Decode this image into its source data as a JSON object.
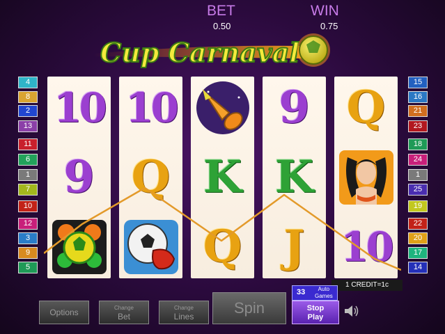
{
  "hud": {
    "bet_label": "BET",
    "bet_value": "0.50",
    "win_label": "WIN",
    "win_value": "0.75"
  },
  "title": "Cup Carnaval",
  "reels": [
    [
      {
        "type": "ten",
        "label": "10",
        "color": "purple"
      },
      {
        "type": "nine",
        "label": "9",
        "color": "purple"
      },
      {
        "type": "icon",
        "icon": "turtle-ball-icon"
      }
    ],
    [
      {
        "type": "ten",
        "label": "10",
        "color": "purple"
      },
      {
        "type": "queen",
        "label": "Q",
        "color": "orange"
      },
      {
        "type": "icon",
        "icon": "ball-glove-icon"
      }
    ],
    [
      {
        "type": "icon",
        "icon": "horn-icon"
      },
      {
        "type": "king",
        "label": "K",
        "color": "green"
      },
      {
        "type": "queen",
        "label": "Q",
        "color": "orange"
      }
    ],
    [
      {
        "type": "nine",
        "label": "9",
        "color": "purple"
      },
      {
        "type": "king",
        "label": "K",
        "color": "green"
      },
      {
        "type": "jack",
        "label": "J",
        "color": "orange"
      }
    ],
    [
      {
        "type": "queen",
        "label": "Q",
        "color": "orange"
      },
      {
        "type": "icon",
        "icon": "carnival-dancer-icon"
      },
      {
        "type": "ten",
        "label": "10",
        "color": "purple"
      }
    ]
  ],
  "paylines_left": [
    {
      "n": "4",
      "color": "#2fb4c8"
    },
    {
      "n": "8",
      "color": "#d9a431"
    },
    {
      "n": "2",
      "color": "#2146d0"
    },
    {
      "n": "13",
      "color": "#8b3fa8"
    },
    {
      "n": "11",
      "color": "#c8202c"
    },
    {
      "n": "6",
      "color": "#22a25b"
    },
    {
      "n": "1",
      "color": "#7a7a7a"
    },
    {
      "n": "7",
      "color": "#a3b81d"
    },
    {
      "n": "10",
      "color": "#c22218"
    },
    {
      "n": "12",
      "color": "#c81f7a"
    },
    {
      "n": "3",
      "color": "#2a7cc8"
    },
    {
      "n": "9",
      "color": "#d88a1f"
    },
    {
      "n": "5",
      "color": "#1f9a57"
    }
  ],
  "paylines_right": [
    {
      "n": "15",
      "color": "#2260c0"
    },
    {
      "n": "16",
      "color": "#2b78c4"
    },
    {
      "n": "21",
      "color": "#d06e1f"
    },
    {
      "n": "23",
      "color": "#b2181f"
    },
    {
      "n": "18",
      "color": "#1f9a57"
    },
    {
      "n": "24",
      "color": "#c81f7a"
    },
    {
      "n": "1",
      "color": "#7a7a7a"
    },
    {
      "n": "25",
      "color": "#4a2db0"
    },
    {
      "n": "19",
      "color": "#c2c81f"
    },
    {
      "n": "22",
      "color": "#c22218"
    },
    {
      "n": "20",
      "color": "#e0a018"
    },
    {
      "n": "17",
      "color": "#1fb47e"
    },
    {
      "n": "14",
      "color": "#2430b8"
    }
  ],
  "credit_text": "1 CREDIT=1c",
  "buttons": {
    "options": "Options",
    "change_bet_top": "Change",
    "change_bet": "Bet",
    "change_lines_top": "Change",
    "change_lines": "Lines",
    "spin": "Spin",
    "auto_count": "33",
    "auto_top": "Auto",
    "auto_bottom": "Games",
    "stop_top": "Stop",
    "stop_bottom": "Play"
  },
  "colors": {
    "accent": "#c77be8",
    "line_orange": "#e39a2a",
    "stop_button": "#7b3fd6"
  }
}
